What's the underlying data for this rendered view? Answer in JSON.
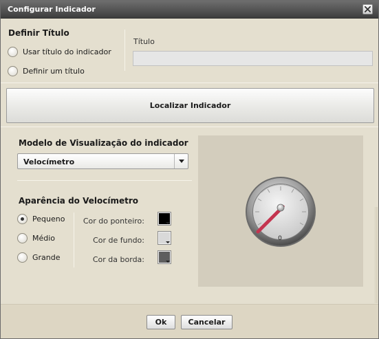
{
  "window": {
    "title": "Configurar Indicador"
  },
  "title_section": {
    "heading": "Definir Título",
    "options": [
      {
        "label": "Usar título do indicador",
        "checked": false
      },
      {
        "label": "Definir um título",
        "checked": false
      }
    ],
    "field_label": "Título",
    "field_value": "",
    "field_placeholder": ""
  },
  "locate_button": {
    "label": "Localizar Indicador"
  },
  "visualization": {
    "heading": "Modelo de Visualização do indicador",
    "selected": "Velocímetro"
  },
  "appearance": {
    "heading": "Aparência do Velocímetro",
    "sizes": [
      {
        "label": "Pequeno",
        "checked": true
      },
      {
        "label": "Médio",
        "checked": false
      },
      {
        "label": "Grande",
        "checked": false
      }
    ],
    "colors": [
      {
        "label": "Cor do ponteiro:",
        "value": "#000000"
      },
      {
        "label": "Cor de fundo:",
        "value": "#d9d9d9"
      },
      {
        "label": "Cor da borda:",
        "value": "#5e5e5e"
      }
    ]
  },
  "gauge": {
    "value_text": "0",
    "needle_color": "#c4344f"
  },
  "footer": {
    "ok_label": "Ok",
    "cancel_label": "Cancelar"
  },
  "theme": {
    "titlebar": "#4a4a4a",
    "panel": "#e4dfcf",
    "preview_bg": "#d3cdbd"
  }
}
